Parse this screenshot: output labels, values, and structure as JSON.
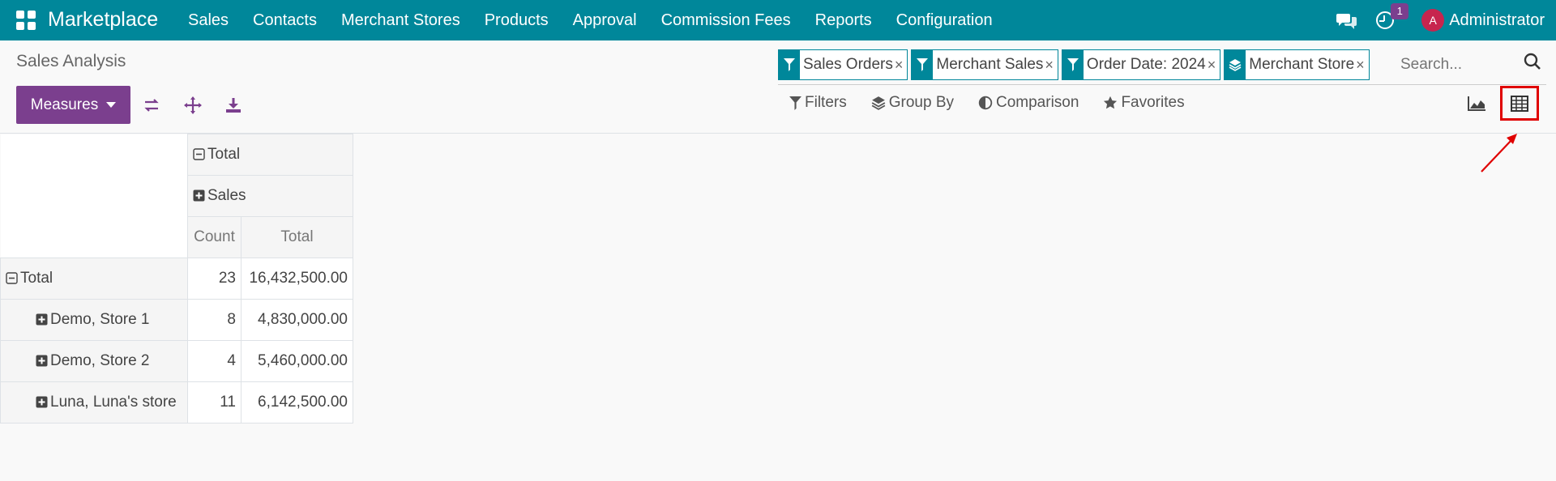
{
  "navbar": {
    "brand": "Marketplace",
    "menu": [
      "Sales",
      "Contacts",
      "Merchant Stores",
      "Products",
      "Approval",
      "Commission Fees",
      "Reports",
      "Configuration"
    ],
    "activity_count": "1",
    "avatar_initial": "A",
    "user": "Administrator"
  },
  "control": {
    "title": "Sales Analysis",
    "measures_label": "Measures",
    "facets": [
      {
        "label": "Sales Orders",
        "icon": "filter-icon"
      },
      {
        "label": "Merchant Sales",
        "icon": "filter-icon"
      },
      {
        "label": "Order Date: 2024",
        "icon": "filter-icon"
      },
      {
        "label": "Merchant Store",
        "icon": "layers-icon"
      }
    ],
    "facet_remove": "×",
    "search_placeholder": "Search...",
    "filters_label": "Filters",
    "groupby_label": "Group By",
    "comparison_label": "Comparison",
    "favorites_label": "Favorites"
  },
  "pivot": {
    "col_header_total": "Total",
    "col_header_sales": "Sales",
    "measure_count": "Count",
    "measure_total": "Total",
    "total_row": {
      "label": "Total",
      "count": "23",
      "total": "16,432,500.00"
    },
    "rows": [
      {
        "label": "Demo, Store 1",
        "count": "8",
        "total": "4,830,000.00"
      },
      {
        "label": "Demo, Store 2",
        "count": "4",
        "total": "5,460,000.00"
      },
      {
        "label": "Luna, Luna's store",
        "count": "11",
        "total": "6,142,500.00"
      }
    ]
  },
  "colors": {
    "primary": "#00879a",
    "accent": "#7b3f8e",
    "highlight": "#e00000"
  }
}
